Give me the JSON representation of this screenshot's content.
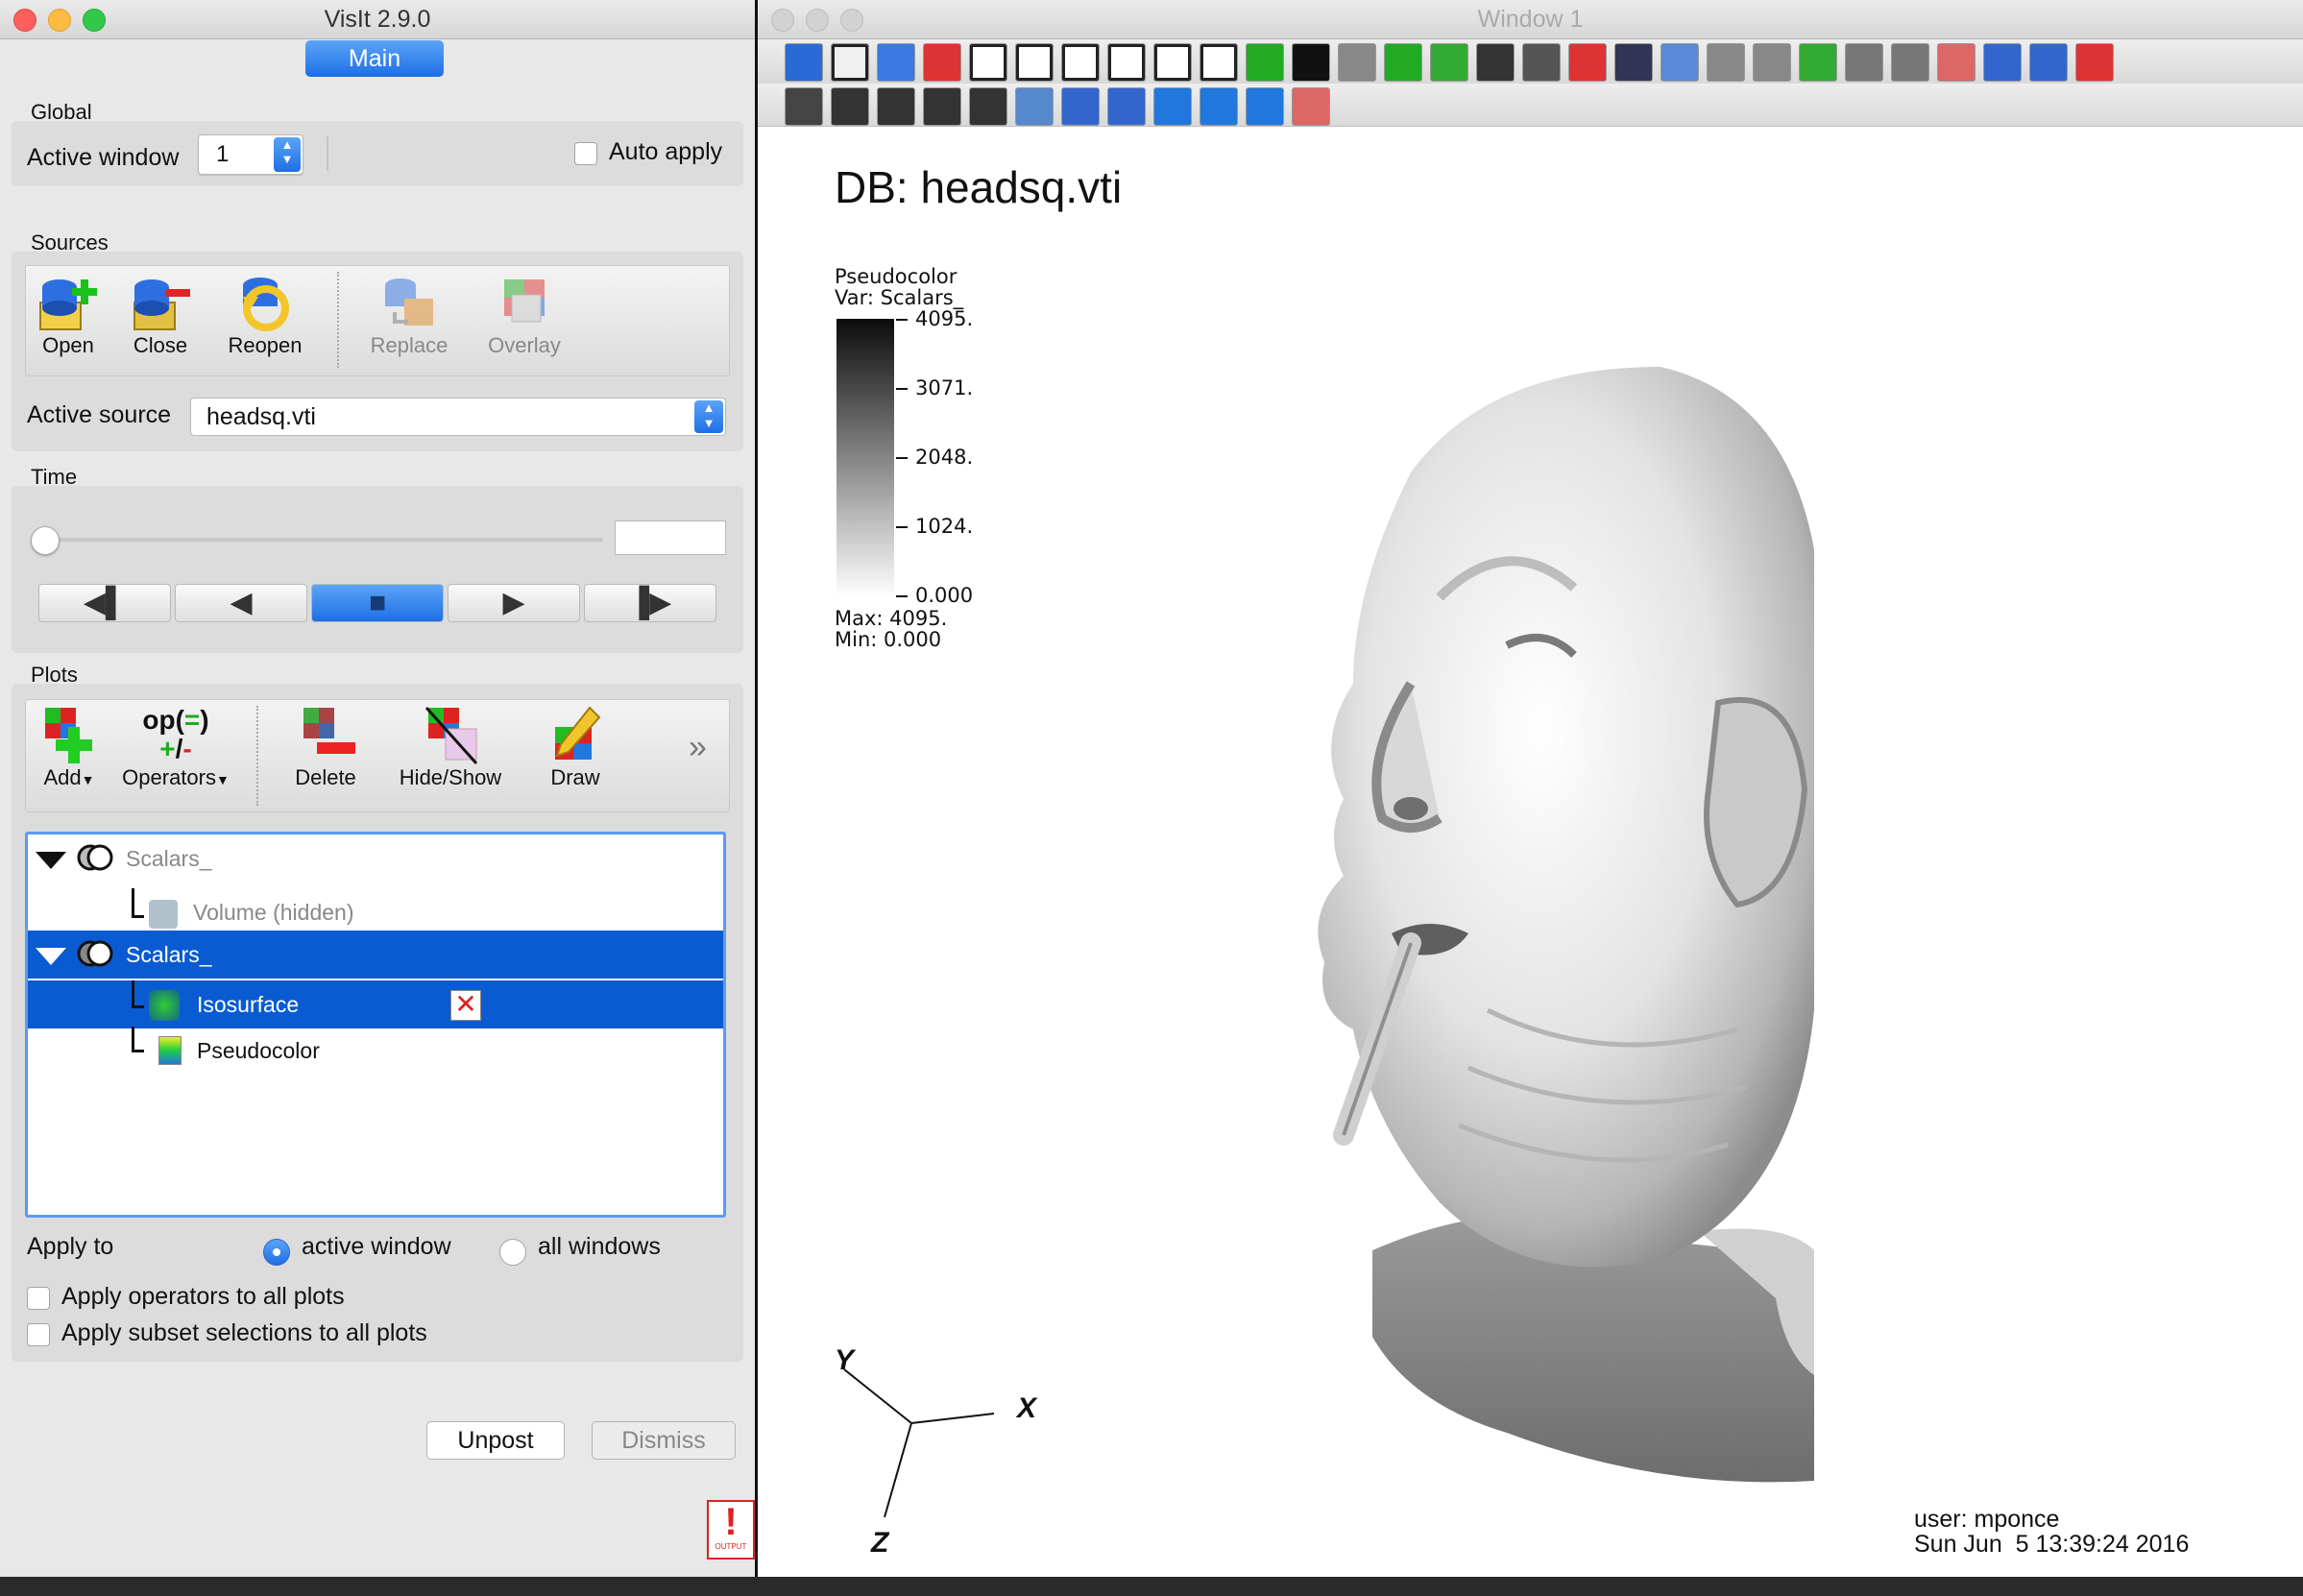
{
  "main_window": {
    "title": "VisIt 2.9.0",
    "tab": "Main",
    "global": {
      "label": "Global",
      "active_window_label": "Active window",
      "active_window_value": "1",
      "auto_apply_label": "Auto apply"
    },
    "sources": {
      "label": "Sources",
      "buttons": [
        "Open",
        "Close",
        "Reopen",
        "Replace",
        "Overlay"
      ],
      "active_source_label": "Active source",
      "active_source_value": "headsq.vti"
    },
    "time": {
      "label": "Time",
      "slider_fraction": 0.0,
      "value": ""
    },
    "plots": {
      "label": "Plots",
      "buttons": [
        "Add",
        "Operators",
        "Delete",
        "Hide/Show",
        "Draw"
      ],
      "operators_icon_text": "op(",
      "more_glyph": "»",
      "items": [
        {
          "name": "Scalars_",
          "selected": false,
          "hidden": true
        },
        {
          "name": "Volume (hidden)",
          "selected": false,
          "hidden": true
        },
        {
          "name": "Scalars_",
          "selected": true,
          "hidden": false
        },
        {
          "name": "Isosurface",
          "selected": true,
          "hidden": false
        },
        {
          "name": "Pseudocolor",
          "selected": false,
          "hidden": false
        }
      ]
    },
    "apply_to": {
      "label": "Apply to",
      "options": [
        "active window",
        "all windows"
      ],
      "selected": "active window",
      "apply_operators_label": "Apply operators to all plots",
      "apply_subset_label": "Apply subset selections to all plots"
    },
    "footer": {
      "unpost": "Unpost",
      "dismiss": "Dismiss",
      "output_badge": "OUTPUT"
    }
  },
  "viewer": {
    "title": "Window 1",
    "db_label": "DB: headsq.vti",
    "legend": {
      "title": "Pseudocolor",
      "var": "Var: Scalars_",
      "ticks": [
        "4095.",
        "3071.",
        "2048.",
        "1024.",
        "0.000"
      ],
      "max": "Max:  4095.",
      "min": "Min:  0.000"
    },
    "axes": {
      "x": "X",
      "y": "Y",
      "z": "Z"
    },
    "user": "user: mponce",
    "date": "Sun Jun  5 13:39:24 2016"
  },
  "colors": {
    "accent": "#1e6fe6",
    "selection": "#0a5bd2",
    "plot_list_border": "#5b9bf0"
  }
}
